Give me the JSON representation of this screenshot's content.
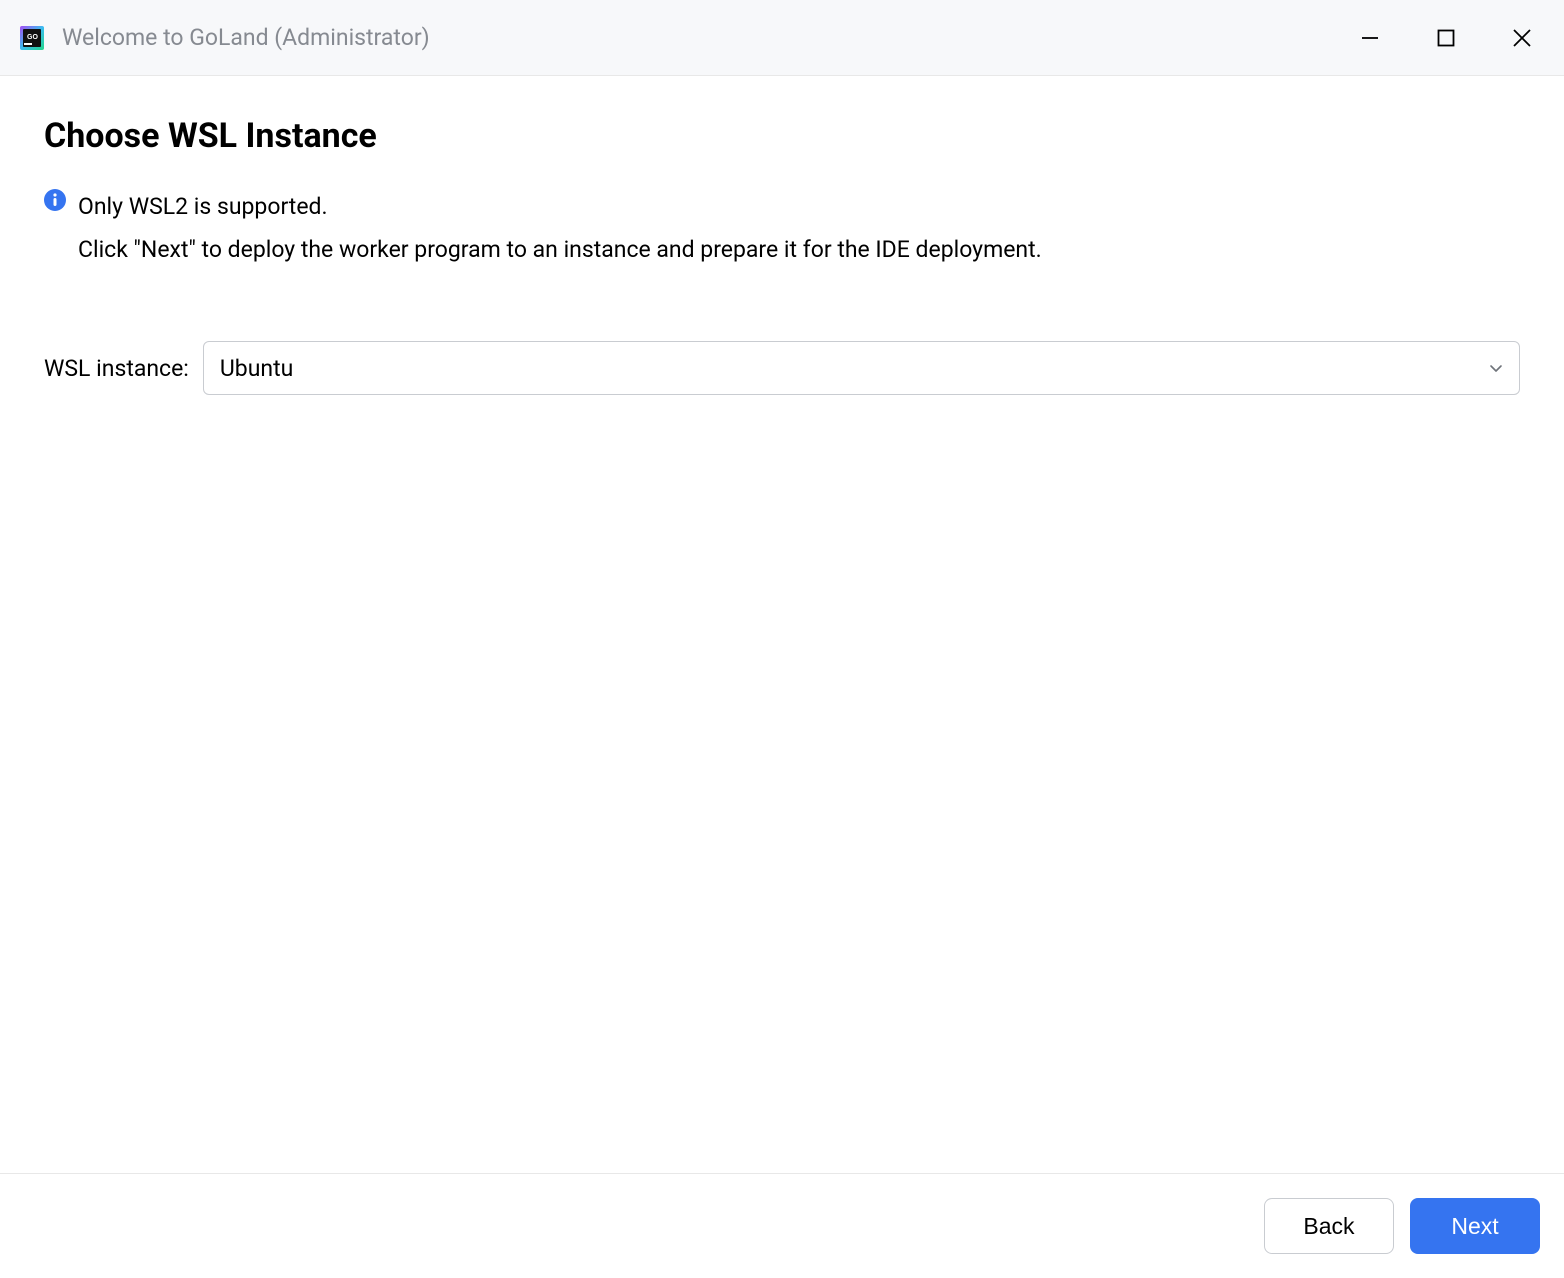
{
  "titlebar": {
    "title": "Welcome to GoLand (Administrator)"
  },
  "page": {
    "heading": "Choose WSL Instance",
    "info_line1": "Only WSL2 is supported.",
    "info_line2": "Click \"Next\" to deploy the worker program to an instance and prepare it for the IDE deployment."
  },
  "form": {
    "wsl_label": "WSL instance:",
    "wsl_selected": "Ubuntu"
  },
  "footer": {
    "back_label": "Back",
    "next_label": "Next"
  },
  "colors": {
    "accent": "#3574f0",
    "info_icon": "#3574f0"
  }
}
